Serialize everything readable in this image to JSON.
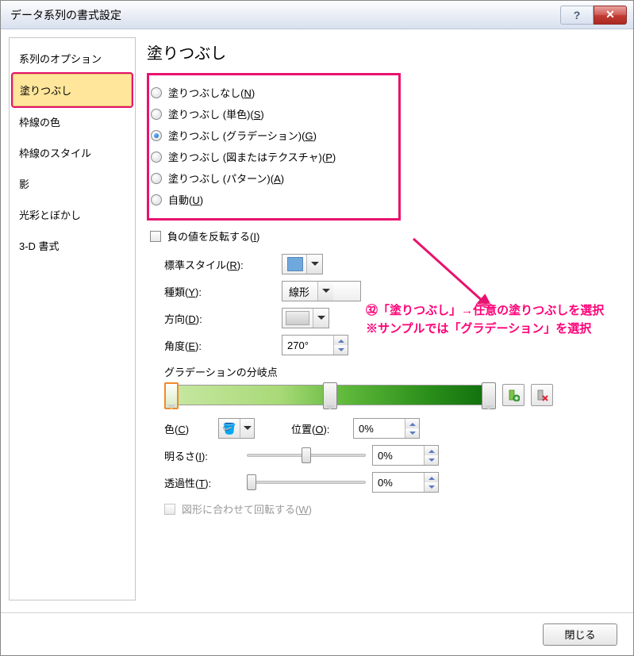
{
  "title": "データ系列の書式設定",
  "titlebar": {
    "help": "?",
    "close": "✕"
  },
  "sidebar": {
    "items": [
      {
        "label": "系列のオプション"
      },
      {
        "label": "塗りつぶし"
      },
      {
        "label": "枠線の色"
      },
      {
        "label": "枠線のスタイル"
      },
      {
        "label": "影"
      },
      {
        "label": "光彩とぼかし"
      },
      {
        "label": "3-D 書式"
      }
    ],
    "selected_index": 1
  },
  "content": {
    "heading": "塗りつぶし",
    "radios": [
      {
        "label_pre": "塗りつぶしなし(",
        "key": "N",
        "label_post": ")"
      },
      {
        "label_pre": "塗りつぶし (単色)(",
        "key": "S",
        "label_post": ")"
      },
      {
        "label_pre": "塗りつぶし (グラデーション)(",
        "key": "G",
        "label_post": ")"
      },
      {
        "label_pre": "塗りつぶし (図またはテクスチャ)(",
        "key": "P",
        "label_post": ")"
      },
      {
        "label_pre": "塗りつぶし (パターン)(",
        "key": "A",
        "label_post": ")"
      },
      {
        "label_pre": "自動(",
        "key": "U",
        "label_post": ")"
      }
    ],
    "selected_radio": 2,
    "invert_neg": {
      "pre": "負の値を反転する(",
      "key": "I",
      "post": ")"
    },
    "preset_label": {
      "pre": "標準スタイル(",
      "key": "R",
      "post": "):"
    },
    "type_label": {
      "pre": "種類(",
      "key": "Y",
      "post": "):"
    },
    "type_value": "線形",
    "direction_label": {
      "pre": "方向(",
      "key": "D",
      "post": "):"
    },
    "angle_label": {
      "pre": "角度(",
      "key": "E",
      "post": "):"
    },
    "angle_value": "270°",
    "stops_label": "グラデーションの分岐点",
    "stops": [
      {
        "pos": 2
      },
      {
        "pos": 50
      },
      {
        "pos": 98
      }
    ],
    "color_label": {
      "pre": "色(",
      "key": "C",
      "post": ")"
    },
    "position_label": {
      "pre": "位置(",
      "key": "O",
      "post": "):"
    },
    "position_value": "0%",
    "brightness_label": {
      "pre": "明るさ(",
      "key": "I",
      "post": "):"
    },
    "brightness_value": "0%",
    "transparency_label": {
      "pre": "透過性(",
      "key": "T",
      "post": "):"
    },
    "transparency_value": "0%",
    "rotate_with_shape": {
      "pre": "図形に合わせて回転する(",
      "key": "W",
      "post": ")"
    }
  },
  "annotation": {
    "line1": "㉜「塗りつぶし」→任意の塗りつぶしを選択",
    "line2": "※サンプルでは「グラデーション」を選択"
  },
  "footer": {
    "close_btn": "閉じる"
  }
}
